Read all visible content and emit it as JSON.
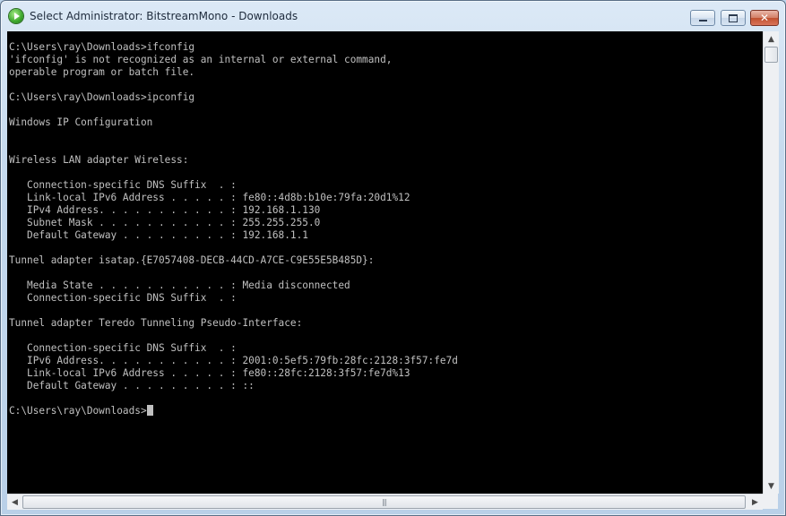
{
  "window": {
    "title": "Select Administrator: BitstreamMono - Downloads",
    "icon": "cmd-app-icon",
    "controls": {
      "minimize": "minimize-icon",
      "maximize": "maximize-icon",
      "close": "✕"
    }
  },
  "console": {
    "lines": [
      "C:\\Users\\ray\\Downloads>ifconfig",
      "'ifconfig' is not recognized as an internal or external command,",
      "operable program or batch file.",
      "",
      "C:\\Users\\ray\\Downloads>ipconfig",
      "",
      "Windows IP Configuration",
      "",
      "",
      "Wireless LAN adapter Wireless:",
      "",
      "   Connection-specific DNS Suffix  . :",
      "   Link-local IPv6 Address . . . . . : fe80::4d8b:b10e:79fa:20d1%12",
      "   IPv4 Address. . . . . . . . . . . : 192.168.1.130",
      "   Subnet Mask . . . . . . . . . . . : 255.255.255.0",
      "   Default Gateway . . . . . . . . . : 192.168.1.1",
      "",
      "Tunnel adapter isatap.{E7057408-DECB-44CD-A7CE-C9E55E5B485D}:",
      "",
      "   Media State . . . . . . . . . . . : Media disconnected",
      "   Connection-specific DNS Suffix  . :",
      "",
      "Tunnel adapter Teredo Tunneling Pseudo-Interface:",
      "",
      "   Connection-specific DNS Suffix  . :",
      "   IPv6 Address. . . . . . . . . . . : 2001:0:5ef5:79fb:28fc:2128:3f57:fe7d",
      "   Link-local IPv6 Address . . . . . : fe80::28fc:2128:3f57:fe7d%13",
      "   Default Gateway . . . . . . . . . : ::",
      ""
    ],
    "prompt": "C:\\Users\\ray\\Downloads>"
  },
  "scrollbars": {
    "up": "▲",
    "down": "▼",
    "left": "◀",
    "right": "▶",
    "grip": "|||"
  },
  "colors": {
    "console_bg": "#000000",
    "console_text": "#c0c0c0"
  }
}
